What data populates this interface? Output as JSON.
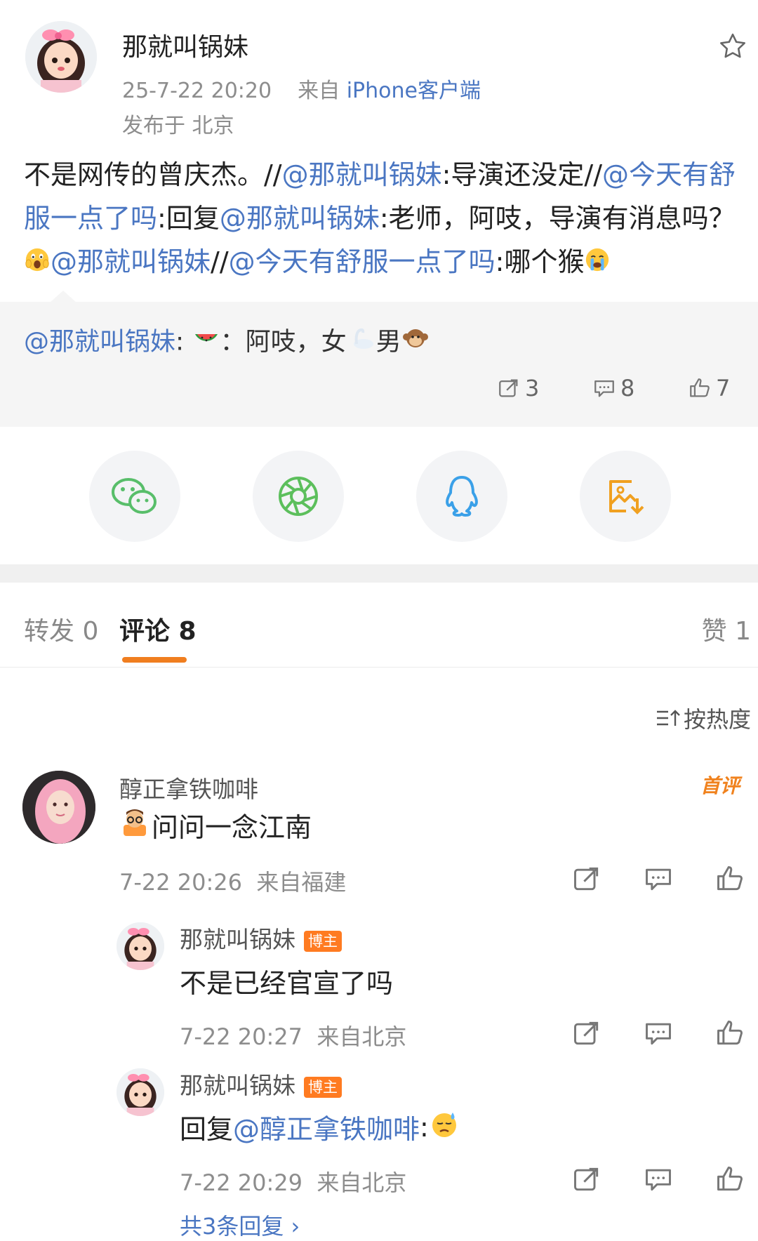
{
  "post": {
    "author": "那就叫锅妹",
    "time": "25-7-22 20:20",
    "source_prefix": "来自",
    "source_client": "iPhone客户端",
    "location": "发布于 北京",
    "body": {
      "seg1": "不是网传的曾庆杰。//",
      "m1": "@那就叫锅妹",
      "seg2": ":导演还没定//",
      "m2": "@今天有舒服一点了吗",
      "seg3": ":回复",
      "m3": "@那就叫锅妹",
      "seg4": ":老师，阿吱，导演有消息吗？",
      "m4": "@那就叫锅妹",
      "seg5": "//",
      "m5": "@今天有舒服一点了吗",
      "seg6": ":哪个猴"
    }
  },
  "quoted": {
    "mention": "@那就叫锅妹",
    "colon": ":",
    "text_a": "：阿吱，女",
    "text_b": "男",
    "repost_count": "3",
    "comment_count": "8",
    "like_count": "7"
  },
  "share": {
    "icons": [
      "wechat-icon",
      "moments-icon",
      "qq-icon",
      "save-image-icon"
    ]
  },
  "tabs": {
    "repost": "转发 0",
    "comments": "评论 8",
    "likes": "赞 1"
  },
  "sort": {
    "label": "按热度"
  },
  "comments": [
    {
      "user": "醇正拿铁咖啡",
      "text": "问问一念江南",
      "meta": "7-22 20:26  来自福建",
      "first_badge": "首评"
    }
  ],
  "replies": [
    {
      "user": "那就叫锅妹",
      "badge": "博主",
      "text": "不是已经官宣了吗",
      "meta": "7-22 20:27  来自北京"
    },
    {
      "user": "那就叫锅妹",
      "badge": "博主",
      "text_prefix": "回复",
      "mention": "@醇正拿铁咖啡",
      "text_suffix": ":",
      "meta": "7-22 20:29  来自北京"
    }
  ],
  "more_replies": "共3条回复 ›",
  "colors": {
    "link": "#4a76c2",
    "accent": "#f07e1f",
    "host_badge": "#ff7b21",
    "wechat": "#58be6a",
    "moments": "#5cbf5c",
    "qq": "#3aa0e8",
    "save": "#f0a020"
  }
}
